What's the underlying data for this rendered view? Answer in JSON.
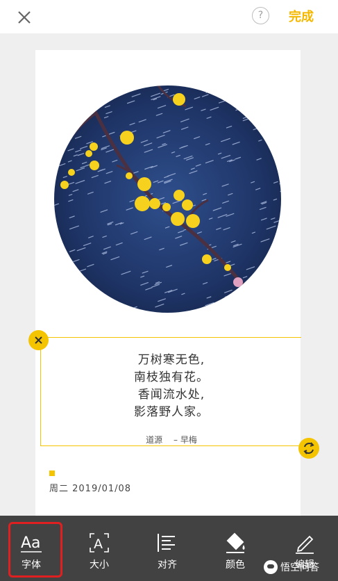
{
  "topbar": {
    "close_icon": "close-icon",
    "help_label": "?",
    "done_label": "完成"
  },
  "card": {
    "photo": "plum-blossom-in-snow",
    "poem_lines": [
      "万树寒无色,",
      "南枝独有花。",
      "香闻流水处,",
      "影落野人家。"
    ],
    "author": "道源",
    "title": "– 早梅",
    "date": "周二 2019/01/08"
  },
  "toolbar": {
    "items": [
      {
        "label": "字体",
        "icon": "font-icon"
      },
      {
        "label": "大小",
        "icon": "text-size-icon"
      },
      {
        "label": "对齐",
        "icon": "align-left-icon"
      },
      {
        "label": "颜色",
        "icon": "paint-bucket-icon"
      },
      {
        "label": "编辑",
        "icon": "pencil-icon"
      }
    ]
  },
  "watermark": {
    "text": "悟空问答"
  },
  "colors": {
    "accent": "#f5c400",
    "done": "#f5b800",
    "toolbar_bg": "#424242",
    "highlight": "#e02020"
  }
}
